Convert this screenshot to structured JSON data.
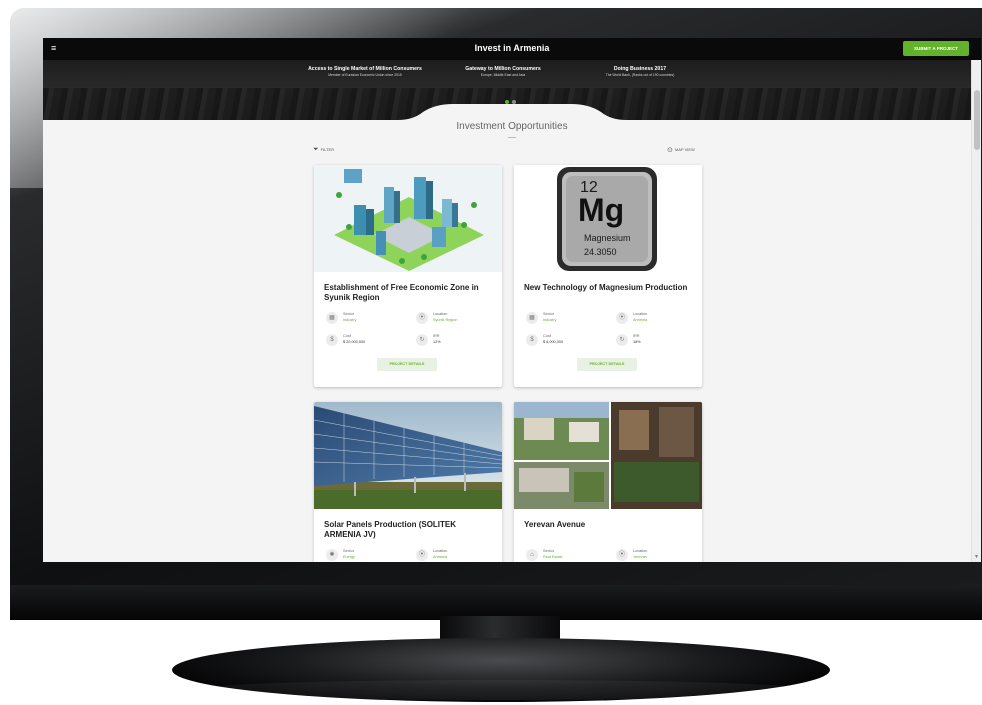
{
  "app": {
    "title": "Invest in Armenia",
    "submit_label": "SUBMIT A PROJECT",
    "accent_color": "#62b32b",
    "menu_icon": "hamburger-icon"
  },
  "hero": {
    "stats": [
      {
        "title": "Access to Single Market of Million Consumers",
        "subtitle": "Member of Eurasian Economic Union since 2015"
      },
      {
        "title": "Gateway to Million Consumers",
        "subtitle": "Europe, Middle East and Asia"
      },
      {
        "title": "Doing Business 2017",
        "subtitle": "The World Bank, (Ranks out of 190 countries)"
      }
    ],
    "slide_count": 2,
    "active_slide": 1
  },
  "section": {
    "title": "Investment Opportunities",
    "filter_label": "FILTER",
    "map_view_label": "MAP VIEW"
  },
  "cards": [
    {
      "title": "Establishment of Free Economic Zone in Syunik Region",
      "sector_label": "Sector",
      "sector": "Industry",
      "location_label": "Location",
      "location": "Syunik Region",
      "cost_label": "Cost",
      "cost": "$ 20,000,000",
      "irr_label": "IRR",
      "irr": "12%",
      "button": "PROJECT DETAILS"
    },
    {
      "title": "New Technology of Magnesium Production",
      "sector_label": "Sector",
      "sector": "Industry",
      "location_label": "Location",
      "location": "Armenia",
      "cost_label": "Cost",
      "cost": "$ 6,000,000",
      "irr_label": "IRR",
      "irr": "18%",
      "button": "PROJECT DETAILS",
      "image": {
        "number": "12",
        "symbol": "Mg",
        "name": "Magnesium",
        "mass": "24.3050"
      }
    },
    {
      "title": "Solar Panels Production (SOLITEK ARMENIA JV)",
      "sector_label": "Sector",
      "sector": "Energy",
      "location_label": "Location",
      "location": "Armenia"
    },
    {
      "title": "Yerevan Avenue",
      "sector_label": "Sector",
      "sector": "Real Estate",
      "location_label": "Location",
      "location": "Yerevan"
    }
  ]
}
